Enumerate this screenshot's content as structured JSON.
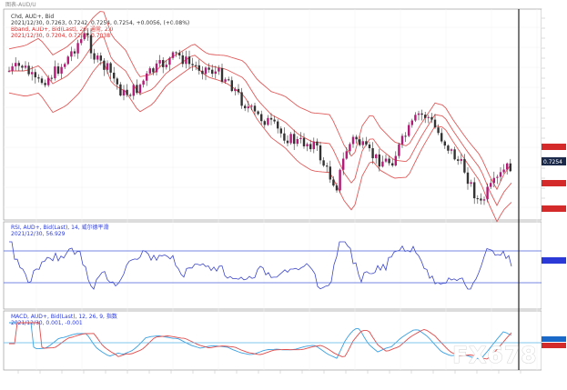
{
  "window": {
    "title": "图表-AUD/U"
  },
  "main_panel": {
    "header_symbol": "Chd, AUD+, Bid",
    "header_ohlc": "2021/12/30, 0.7263, 0.7242, 0.7254, 0.7254, +0.0056, (+0.08%)",
    "indicator_label": "Bband, AUD+, Bid(Last), 20, 通常, 2.0",
    "indicator_values": "2021/12/30, 0.7204, 0.7263, 0.7038",
    "price_badges": [
      "0.7254"
    ]
  },
  "rsi_panel": {
    "label": "RSI, AUD+, Bid(Last), 14, 威尔德平滑",
    "values": "2021/12/30, 56.929"
  },
  "macd_panel": {
    "label": "MACD, AUD+, Bid(Last), 12, 26, 9, 指数",
    "values": "2021/12/30, 0.001, -0.001"
  },
  "watermark": "FX678",
  "colors": {
    "candle_body": "#b41a78",
    "bollinger": "#e05a5a",
    "rsi_line": "#3c46c8",
    "macd_line": "#3aa0e0",
    "signal_line": "#e04a4a",
    "level_line": "#4a62d6",
    "cursor_line": "#222222"
  }
}
